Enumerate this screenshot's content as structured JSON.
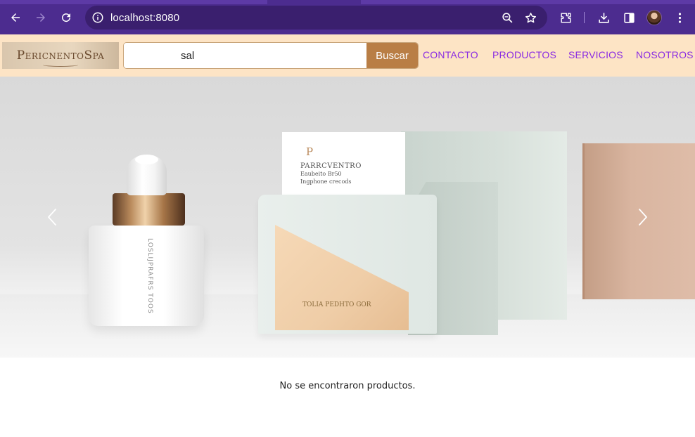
{
  "browser": {
    "url": "localhost:8080",
    "icons": [
      "back-arrow-icon",
      "forward-arrow-icon",
      "reload-icon",
      "site-info-icon",
      "zoom-icon",
      "bookmark-star-icon",
      "extensions-icon",
      "download-icon",
      "side-panel-icon",
      "profile-avatar",
      "kebab-menu-icon"
    ],
    "colors": {
      "frame": "#4c2c8f",
      "omnibox": "#3a1f6e"
    }
  },
  "header": {
    "logo_text": "PericnentoSpa",
    "search": {
      "value": "sal",
      "button_label": "Buscar"
    },
    "nav": [
      "CONTACTO",
      "PRODUCTOS",
      "SERVICIOS",
      "NOSOTROS"
    ],
    "colors": {
      "background": "#fde4c5",
      "button": "#b97e45",
      "link": "#8a2be2"
    }
  },
  "carousel": {
    "slide": {
      "card_title": "PARRCVENTRO",
      "card_line1": "Eaubeito Br50",
      "card_line2": "Ingphone crecods",
      "bottle_label": "LOSLIJPRAFRS TOOS",
      "box_label": "TOLIA PEDHTO GOR"
    },
    "controls": [
      "chevron-left-icon",
      "chevron-right-icon"
    ]
  },
  "results": {
    "message": "No se encontraron productos."
  }
}
